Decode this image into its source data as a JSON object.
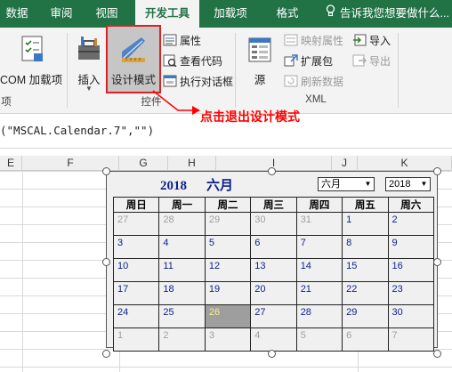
{
  "ribbon_tabs": {
    "data": "数据",
    "review": "审阅",
    "view": "视图",
    "developer": "开发工具",
    "addins": "加载项",
    "format": "格式",
    "tell_me": "告诉我您想要做什么..."
  },
  "ribbon": {
    "com_addins": "COM 加载项",
    "insert": "插入",
    "design_mode": "设计模式",
    "properties": "属性",
    "view_code": "查看代码",
    "run_dialog": "执行对话框",
    "controls_group": "控件",
    "source": "源",
    "map_properties": "映射属性",
    "expansion_packs": "扩展包",
    "refresh_data": "刷新数据",
    "import": "导入",
    "export": "导出",
    "xml_group": "XML",
    "left_group_tail": "项"
  },
  "annotation": "点击退出设计模式",
  "formula": "(\"MSCAL.Calendar.7\",\"\")",
  "columns": [
    "E",
    "F",
    "G",
    "H",
    "I",
    "J",
    "K"
  ],
  "calendar": {
    "year": "2018",
    "month": "六月",
    "month_select": "六月",
    "year_select": "2018",
    "weekdays": [
      "周日",
      "周一",
      "周二",
      "周三",
      "周四",
      "周五",
      "周六"
    ],
    "weeks": [
      [
        "27",
        "28",
        "29",
        "30",
        "31",
        "1",
        "2"
      ],
      [
        "3",
        "4",
        "5",
        "6",
        "7",
        "8",
        "9"
      ],
      [
        "10",
        "11",
        "12",
        "13",
        "14",
        "15",
        "16"
      ],
      [
        "17",
        "18",
        "19",
        "20",
        "21",
        "22",
        "23"
      ],
      [
        "24",
        "25",
        "26",
        "27",
        "28",
        "29",
        "30"
      ],
      [
        "1",
        "2",
        "3",
        "4",
        "5",
        "6",
        "7"
      ]
    ],
    "selected_day": "26"
  },
  "colors": {
    "ribbon_green": "#217346",
    "annotation_red": "#ff0000",
    "calendar_text": "#0b1f8a"
  }
}
